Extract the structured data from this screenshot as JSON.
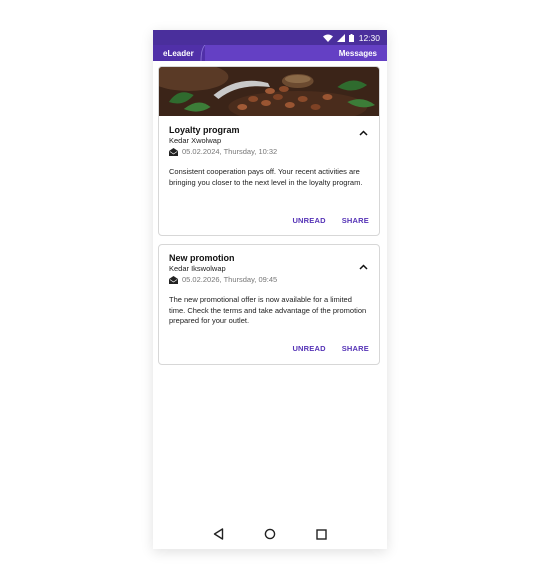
{
  "status_bar": {
    "time": "12:30",
    "icons": [
      "wifi-icon",
      "cellular-signal-icon",
      "battery-icon"
    ]
  },
  "app_bar": {
    "brand": "eLeader",
    "title": "Messages"
  },
  "colors": {
    "status_bar": "#4a2f9c",
    "app_bar": "#6440c4",
    "accent": "#5533b6"
  },
  "messages": [
    {
      "title": "Loyalty program",
      "sender": "Kedar Xwolwap",
      "date": "05.02.2024, Thursday, 10:32",
      "body": "Consistent cooperation pays off. Your recent activities are bringing you closer to the next level in the loyalty program.",
      "has_image": true,
      "image_icon": "cocoa-beans-image",
      "expanded": true,
      "actions": [
        "UNREAD",
        "SHARE"
      ]
    },
    {
      "title": "New promotion",
      "sender": "Kedar Ikswolwap",
      "date": "05.02.2026, Thursday, 09:45",
      "body": "The new promotional offer is now available for a limited time. Check the terms and take advantage of the promotion prepared for your outlet.",
      "has_image": false,
      "expanded": true,
      "actions": [
        "UNREAD",
        "SHARE"
      ]
    }
  ],
  "nav_bar": {
    "buttons": [
      "back-icon",
      "home-icon",
      "recents-icon"
    ]
  }
}
